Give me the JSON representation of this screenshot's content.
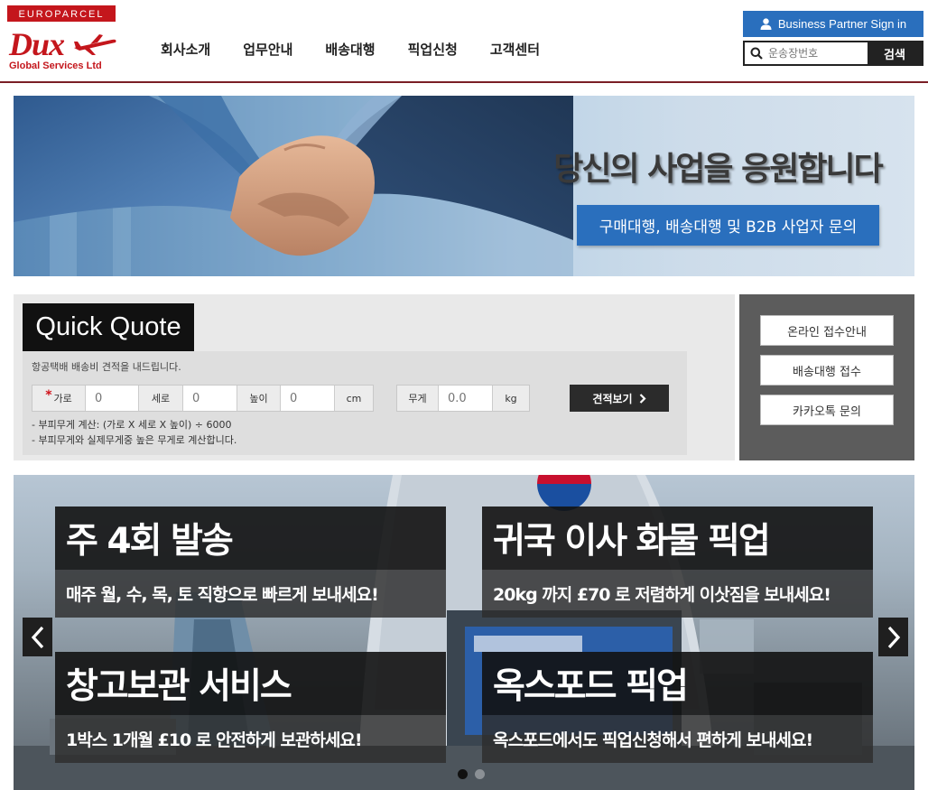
{
  "brand": {
    "top": "EUROPARCEL",
    "name": "Dux",
    "sub": "Global Services Ltd",
    "color": "#c4161c"
  },
  "nav": [
    {
      "label": "회사소개"
    },
    {
      "label": "업무안내"
    },
    {
      "label": "배송대행"
    },
    {
      "label": "픽업신청"
    },
    {
      "label": "고객센터"
    }
  ],
  "header": {
    "partner_label": "Business Partner Sign in",
    "search_placeholder": "운송장번호",
    "search_value": "",
    "search_button": "검색"
  },
  "hero": {
    "title": "당신의 사업을 응원합니다",
    "button": "구매대행, 배송대행 및 B2B 사업자 문의"
  },
  "quote": {
    "title": "Quick Quote",
    "description": "항공택배 배송비 견적을 내드립니다.",
    "required_mark": "*",
    "width_label": "가로",
    "width_placeholder": "0",
    "length_label": "세로",
    "length_placeholder": "0",
    "height_label": "높이",
    "height_placeholder": "0",
    "dim_unit": "cm",
    "weight_label": "무게",
    "weight_placeholder": "0.0",
    "weight_unit": "kg",
    "button": "견적보기",
    "notes": [
      "- 부피무게 계산: (가로 X 세로 X 높이) ÷ 6000",
      "- 부피무게와 실제무게중 높은 무게로 계산합니다."
    ]
  },
  "side_menu": [
    {
      "label": "온라인 접수안내"
    },
    {
      "label": "배송대행 접수"
    },
    {
      "label": "카카오톡 문의"
    }
  ],
  "services": [
    {
      "title": "주 4회 발송",
      "subtitle": "매주 월, 수, 목, 토 직항으로 빠르게 보내세요!"
    },
    {
      "title": "귀국 이사 화물 픽업",
      "subtitle": "20kg 까지 £70 로 저렴하게 이삿짐을 보내세요!"
    },
    {
      "title": "창고보관 서비스",
      "subtitle": "1박스  1개월  £10 로 안전하게 보관하세요!"
    },
    {
      "title": "옥스포드 픽업",
      "subtitle": "옥스포드에서도 픽업신청해서 편하게 보내세요!"
    }
  ],
  "slider": {
    "active_index": 0,
    "total": 2,
    "prev_icon": "chevron-left-icon",
    "next_icon": "chevron-right-icon"
  },
  "colors": {
    "accent_blue": "#2a6fbd",
    "header_rule": "#7a1f25",
    "dark": "#222222"
  }
}
